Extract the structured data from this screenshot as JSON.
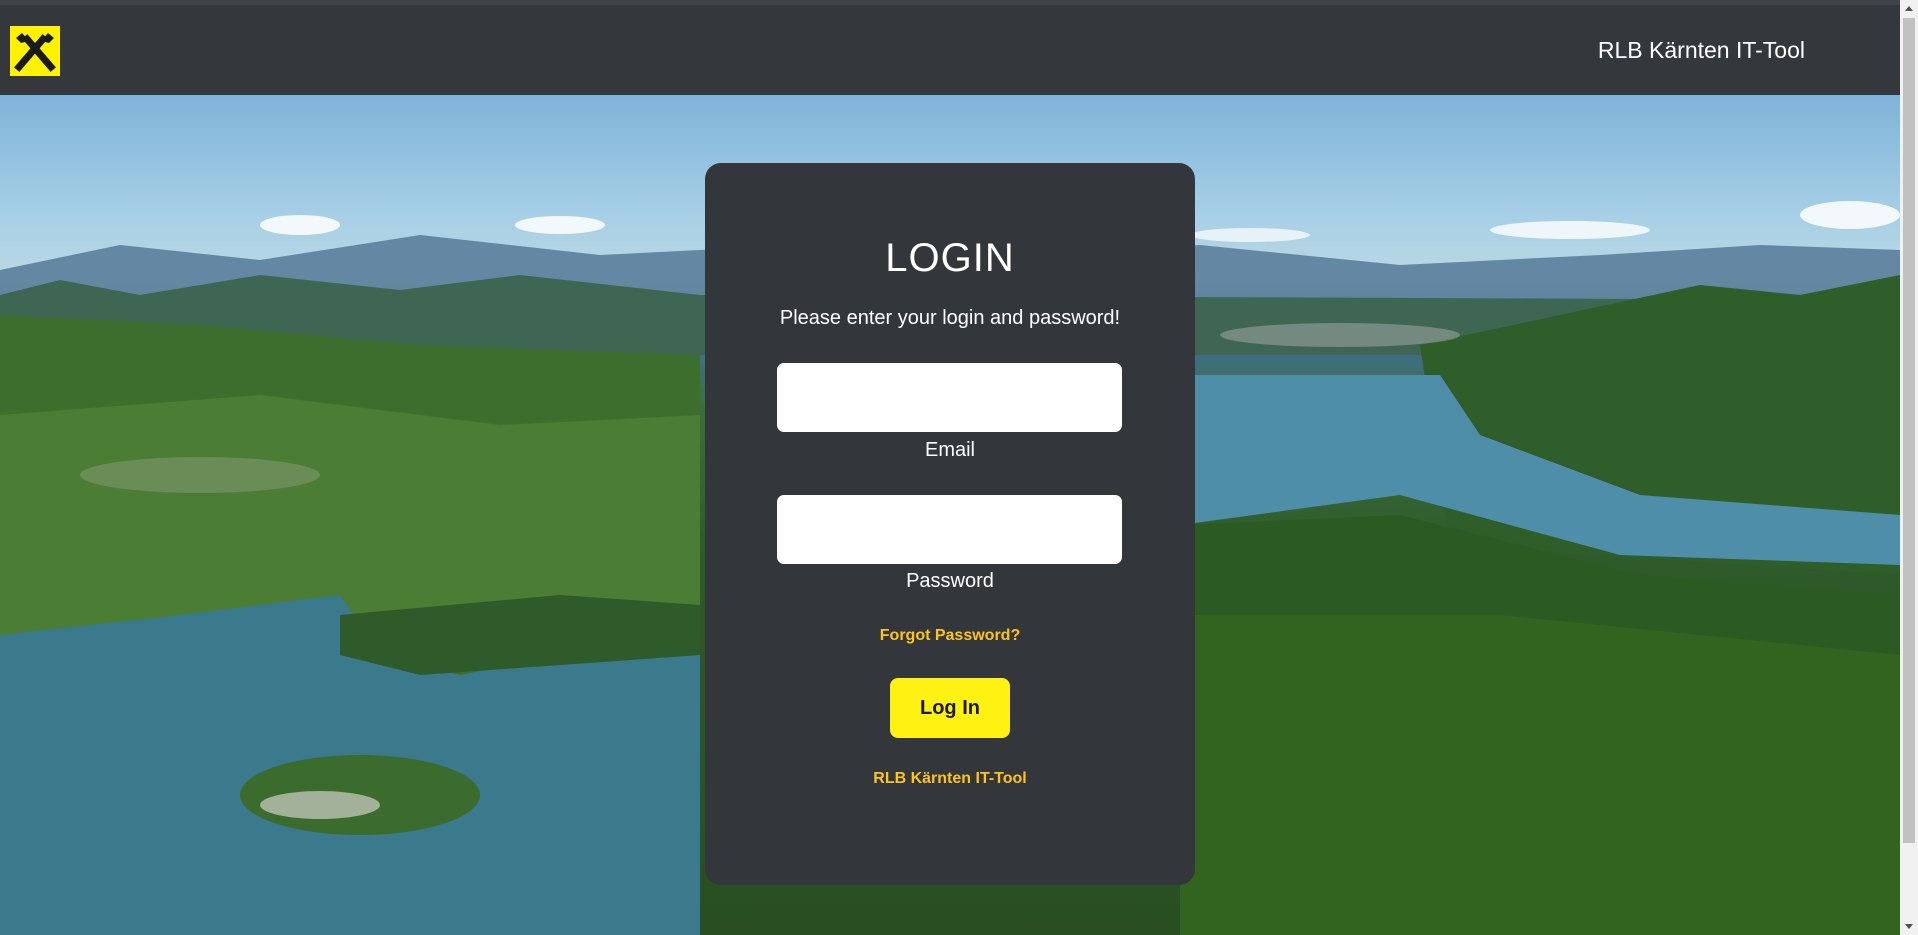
{
  "navbar": {
    "logo_icon": "raiffeisen-crossed-horse-heads-icon",
    "title": "RLB Kärnten IT-Tool",
    "background": "#34373c"
  },
  "background_image": "lake-landscape-photo",
  "login": {
    "title": "LOGIN",
    "subtitle": "Please enter your login and password!",
    "email": {
      "label": "Email",
      "value": "",
      "placeholder": ""
    },
    "password": {
      "label": "Password",
      "value": "",
      "placeholder": ""
    },
    "forgot_password": "Forgot Password?",
    "login_button": "Log In",
    "footer_link": "RLB Kärnten IT-Tool"
  },
  "colors": {
    "accent_yellow": "#fff212",
    "link_yellow": "#fdc419",
    "card_background": "#33363b"
  }
}
